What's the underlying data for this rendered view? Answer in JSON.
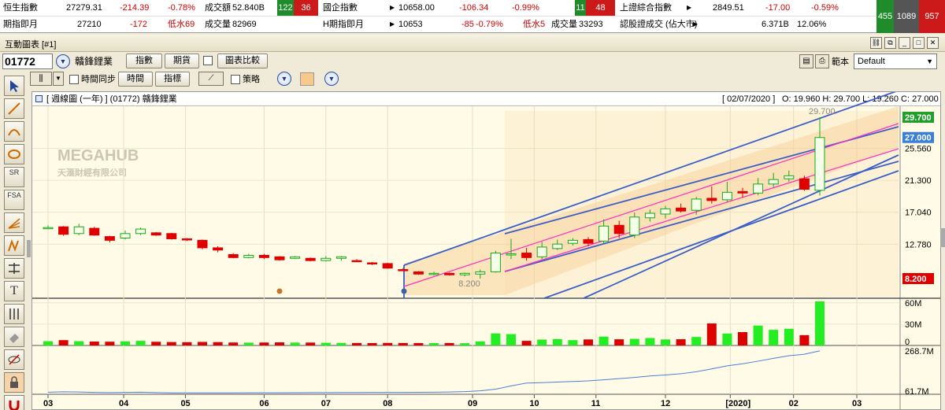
{
  "ticker": {
    "row1": [
      {
        "name": "恒生指數",
        "value": "27279.31",
        "change": "-214.39",
        "pct": "-0.78%",
        "vol_label": "成交額",
        "vol": "52.840B",
        "up": "122",
        "down": "36"
      },
      {
        "name": "國企指數",
        "value": "10658.00",
        "change": "-106.34",
        "pct": "-0.99%",
        "up": "11",
        "down": "48"
      },
      {
        "name": "上證綜合指數",
        "value": "2849.51",
        "change": "-17.00",
        "pct": "-0.59%"
      }
    ],
    "row2": [
      {
        "name": "期指即月",
        "value": "27210",
        "change": "-172",
        "note": "低水69",
        "vol_label": "成交量",
        "vol": "82969"
      },
      {
        "name": "H期指即月",
        "value": "10653",
        "change": "-85",
        "pct": "-0.79%",
        "note": "低水5",
        "vol_label": "成交量",
        "vol": "33293"
      },
      {
        "name": "認股證成交 (佔大市)",
        "value": "6.371B",
        "pct": "12.06%"
      }
    ],
    "breadth": {
      "up": "455",
      "flat": "1089",
      "down": "957"
    }
  },
  "window": {
    "title": "互動圖表 [#1]"
  },
  "toolbar": {
    "code": "01772",
    "stock_name": "贛鋒鋰業",
    "index_btn": "指數",
    "futures_btn": "期貨",
    "compare_label": "圖表比較",
    "template_label": "範本",
    "template_value": "Default",
    "time_sync_label": "時間同步",
    "time_btn": "時間",
    "indicator_btn": "指標",
    "strategy_label": "策略"
  },
  "chart_header": {
    "title": "[ 週線圖 (一年)  ]  (01772)  贛鋒鋰業",
    "date": "[ 02/07/2020 ]",
    "ohlc": "O: 19.960  H: 29.700  L: 19.260  C: 27.000"
  },
  "watermark": {
    "brand": "MEGAHUB",
    "company": "天滙財經有限公司"
  },
  "colors": {
    "up": "#18a818",
    "down": "#e00000",
    "volume_up": "#22ee22",
    "volume_down": "#dd0000",
    "channel": "#3a5fc8",
    "ma": "#ff30c0",
    "band": "#f7c98a",
    "last_price_badge": "#3a7fd8",
    "high_badge": "#1f9e2a",
    "low_badge": "#e00000"
  },
  "chart_data": {
    "type": "candlestick",
    "price_ticks": [
      "29.700",
      "27.000",
      "25.560",
      "21.300",
      "17.040",
      "12.780",
      "8.200"
    ],
    "volume_ticks": [
      "60M",
      "30M",
      "0"
    ],
    "obv_ticks": [
      "268.7M",
      "61.7M"
    ],
    "x_ticks": [
      "03",
      "04",
      "05",
      "06",
      "07",
      "08",
      "09",
      "10",
      "11",
      "12",
      "[2020]",
      "02",
      "03"
    ],
    "annotations": {
      "high": "29.700",
      "low": "8.200"
    },
    "last": "27.000",
    "candles": [
      {
        "o": 14.9,
        "c": 15.0,
        "h": 15.3,
        "l": 14.8
      },
      {
        "o": 15.1,
        "c": 14.1,
        "h": 15.2,
        "l": 13.9
      },
      {
        "o": 14.2,
        "c": 15.1,
        "h": 15.5,
        "l": 14.0
      },
      {
        "o": 14.9,
        "c": 14.0,
        "h": 15.1,
        "l": 13.9
      },
      {
        "o": 13.8,
        "c": 13.3,
        "h": 13.9,
        "l": 13.0
      },
      {
        "o": 13.6,
        "c": 14.2,
        "h": 14.6,
        "l": 13.4
      },
      {
        "o": 14.2,
        "c": 14.8,
        "h": 15.0,
        "l": 14.0
      },
      {
        "o": 14.3,
        "c": 14.0,
        "h": 14.4,
        "l": 13.9
      },
      {
        "o": 14.2,
        "c": 13.5,
        "h": 14.3,
        "l": 13.4
      },
      {
        "o": 13.5,
        "c": 13.4,
        "h": 13.6,
        "l": 13.2
      },
      {
        "o": 13.3,
        "c": 12.3,
        "h": 13.4,
        "l": 12.1
      },
      {
        "o": 12.3,
        "c": 12.0,
        "h": 12.5,
        "l": 11.7
      },
      {
        "o": 11.4,
        "c": 11.0,
        "h": 11.6,
        "l": 10.9
      },
      {
        "o": 11.0,
        "c": 11.3,
        "h": 11.5,
        "l": 10.9
      },
      {
        "o": 11.3,
        "c": 11.0,
        "h": 11.5,
        "l": 10.8
      },
      {
        "o": 11.1,
        "c": 10.7,
        "h": 11.2,
        "l": 10.6
      },
      {
        "o": 10.9,
        "c": 11.1,
        "h": 11.2,
        "l": 10.8
      },
      {
        "o": 10.9,
        "c": 10.6,
        "h": 11.0,
        "l": 10.5
      },
      {
        "o": 10.6,
        "c": 10.9,
        "h": 11.2,
        "l": 10.5
      },
      {
        "o": 10.9,
        "c": 11.1,
        "h": 11.2,
        "l": 10.6
      },
      {
        "o": 10.6,
        "c": 10.5,
        "h": 10.8,
        "l": 10.4
      },
      {
        "o": 10.3,
        "c": 10.2,
        "h": 10.4,
        "l": 10.0
      },
      {
        "o": 10.2,
        "c": 9.6,
        "h": 10.3,
        "l": 9.5
      },
      {
        "o": 9.4,
        "c": 9.3,
        "h": 9.6,
        "l": 9.2
      },
      {
        "o": 9.1,
        "c": 8.8,
        "h": 9.2,
        "l": 8.7
      },
      {
        "o": 8.8,
        "c": 8.9,
        "h": 9.1,
        "l": 8.6
      },
      {
        "o": 8.9,
        "c": 8.7,
        "h": 9.0,
        "l": 8.6
      },
      {
        "o": 8.7,
        "c": 8.9,
        "h": 9.0,
        "l": 8.5
      },
      {
        "o": 8.8,
        "c": 9.1,
        "h": 9.4,
        "l": 8.2
      },
      {
        "o": 9.1,
        "c": 11.6,
        "h": 11.9,
        "l": 9.0
      },
      {
        "o": 11.4,
        "c": 11.5,
        "h": 13.5,
        "l": 10.8
      },
      {
        "o": 11.6,
        "c": 11.0,
        "h": 12.3,
        "l": 10.6
      },
      {
        "o": 11.1,
        "c": 12.4,
        "h": 13.1,
        "l": 10.8
      },
      {
        "o": 12.2,
        "c": 12.8,
        "h": 13.4,
        "l": 12.0
      },
      {
        "o": 12.9,
        "c": 13.3,
        "h": 13.6,
        "l": 12.6
      },
      {
        "o": 13.4,
        "c": 12.9,
        "h": 13.7,
        "l": 12.5
      },
      {
        "o": 13.2,
        "c": 15.2,
        "h": 16.1,
        "l": 12.9
      },
      {
        "o": 15.3,
        "c": 14.2,
        "h": 15.9,
        "l": 13.6
      },
      {
        "o": 14.0,
        "c": 16.4,
        "h": 17.0,
        "l": 13.6
      },
      {
        "o": 16.3,
        "c": 16.9,
        "h": 17.4,
        "l": 15.8
      },
      {
        "o": 16.8,
        "c": 17.5,
        "h": 17.9,
        "l": 16.2
      },
      {
        "o": 17.6,
        "c": 17.2,
        "h": 18.2,
        "l": 17.0
      },
      {
        "o": 17.3,
        "c": 18.8,
        "h": 19.1,
        "l": 16.7
      },
      {
        "o": 18.9,
        "c": 18.6,
        "h": 20.5,
        "l": 18.2
      },
      {
        "o": 18.7,
        "c": 19.7,
        "h": 21.1,
        "l": 18.4
      },
      {
        "o": 19.8,
        "c": 19.6,
        "h": 20.3,
        "l": 19.0
      },
      {
        "o": 19.6,
        "c": 20.8,
        "h": 21.6,
        "l": 19.3
      },
      {
        "o": 20.8,
        "c": 21.4,
        "h": 22.3,
        "l": 20.4
      },
      {
        "o": 21.5,
        "c": 21.9,
        "h": 22.6,
        "l": 21.1
      },
      {
        "o": 21.5,
        "c": 20.1,
        "h": 21.9,
        "l": 19.9
      },
      {
        "o": 19.96,
        "c": 27.0,
        "h": 29.7,
        "l": 19.26
      }
    ],
    "volume": [
      6.0,
      7.5,
      6.0,
      5.5,
      5.3,
      5.8,
      6.5,
      5.2,
      4.8,
      4.6,
      5.0,
      4.7,
      4.2,
      4.0,
      4.2,
      4.4,
      4.1,
      4.1,
      3.8,
      3.6,
      3.5,
      3.4,
      3.6,
      3.5,
      3.4,
      3.3,
      3.5,
      3.2,
      5.8,
      17.0,
      16.0,
      6.5,
      8.3,
      9.0,
      7.5,
      8.5,
      12.5,
      8.7,
      9.3,
      10.5,
      8.5,
      8.8,
      12.0,
      31.0,
      16.8,
      18.8,
      28.0,
      22.0,
      23.5,
      14.5,
      62.0
    ],
    "obv": [
      65,
      67,
      66,
      64,
      63,
      64,
      65,
      63,
      62,
      62,
      61.7,
      61.9,
      62,
      62.3,
      62.1,
      62.5,
      62.7,
      63,
      63.4,
      63.6,
      63.8,
      64,
      64.1,
      64.3,
      64.5,
      65,
      66,
      68,
      72,
      80,
      96,
      110,
      112,
      115,
      118,
      121,
      126,
      132,
      138,
      145,
      150,
      156,
      166,
      180,
      195,
      205,
      218,
      232,
      245,
      252,
      268.7
    ]
  }
}
